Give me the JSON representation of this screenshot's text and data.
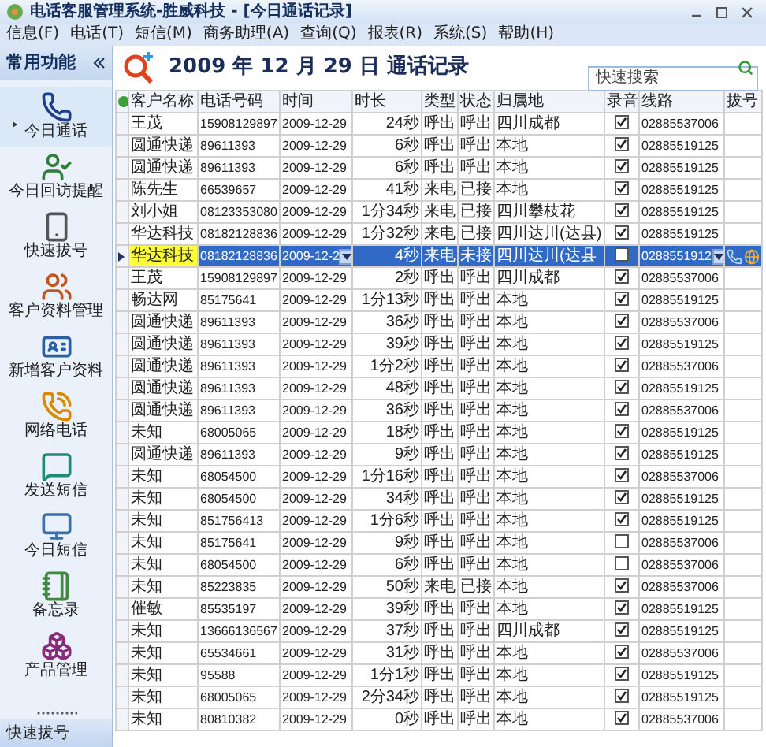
{
  "window": {
    "title": "电话客服管理系统-胜威科技 - [今日通话记录]"
  },
  "menu": [
    "信息(F)",
    "电话(T)",
    "短信(M)",
    "商务助理(A)",
    "查询(Q)",
    "报表(R)",
    "系统(S)",
    "帮助(H)"
  ],
  "sidebar": {
    "title": "常用功能",
    "items": [
      {
        "label": "今日通话",
        "selected": true
      },
      {
        "label": "今日回访提醒",
        "selected": false
      },
      {
        "label": "快速拔号",
        "selected": false
      },
      {
        "label": "客户资料管理",
        "selected": false
      },
      {
        "label": "新增客户资料",
        "selected": false
      },
      {
        "label": "网络电话",
        "selected": false
      },
      {
        "label": "发送短信",
        "selected": false
      },
      {
        "label": "今日短信",
        "selected": false
      },
      {
        "label": "备忘录",
        "selected": false
      },
      {
        "label": "产品管理",
        "selected": false
      }
    ],
    "footer": "快速拔号"
  },
  "header": {
    "title": "2009 年 12 月 29 日 通话记录",
    "search": {
      "placeholder": "快速搜索"
    }
  },
  "table": {
    "columns": [
      "客户名称",
      "电话号码",
      "时间",
      "时长",
      "类型",
      "状态",
      "归属地",
      "录音",
      "线路",
      "拔号"
    ],
    "rows": [
      {
        "name": "王茂",
        "phone": "15908129897",
        "time": "2009-12-29",
        "duration": "24秒",
        "type": "呼出",
        "status": "呼出",
        "location": "四川成都",
        "recorded": true,
        "line": "02885537006",
        "selected": false
      },
      {
        "name": "圆通快递",
        "phone": "89611393",
        "time": "2009-12-29",
        "duration": "6秒",
        "type": "呼出",
        "status": "呼出",
        "location": "本地",
        "recorded": true,
        "line": "02885519125",
        "selected": false
      },
      {
        "name": "圆通快递",
        "phone": "89611393",
        "time": "2009-12-29",
        "duration": "6秒",
        "type": "呼出",
        "status": "呼出",
        "location": "本地",
        "recorded": true,
        "line": "02885519125",
        "selected": false
      },
      {
        "name": "陈先生",
        "phone": "66539657",
        "time": "2009-12-29",
        "duration": "41秒",
        "type": "来电",
        "status": "已接",
        "location": "本地",
        "recorded": true,
        "line": "02885519125",
        "selected": false
      },
      {
        "name": "刘小姐",
        "phone": "08123353080",
        "time": "2009-12-29",
        "duration": "1分34秒",
        "type": "来电",
        "status": "已接",
        "location": "四川攀枝花",
        "recorded": true,
        "line": "02885519125",
        "selected": false
      },
      {
        "name": "华达科技",
        "phone": "08182128836",
        "time": "2009-12-29",
        "duration": "1分32秒",
        "type": "来电",
        "status": "已接",
        "location": "四川达川(达县)",
        "recorded": true,
        "line": "02885519125",
        "selected": false
      },
      {
        "name": "华达科技",
        "phone": "08182128836",
        "time": "2009-12-2",
        "duration": "4秒",
        "type": "来电",
        "status": "未接",
        "location": "四川达川(达县",
        "recorded": false,
        "line": "0288551912",
        "selected": true
      },
      {
        "name": "王茂",
        "phone": "15908129897",
        "time": "2009-12-29",
        "duration": "2秒",
        "type": "呼出",
        "status": "呼出",
        "location": "四川成都",
        "recorded": true,
        "line": "02885537006",
        "selected": false
      },
      {
        "name": "畅达网",
        "phone": "85175641",
        "time": "2009-12-29",
        "duration": "1分13秒",
        "type": "呼出",
        "status": "呼出",
        "location": "本地",
        "recorded": true,
        "line": "02885519125",
        "selected": false
      },
      {
        "name": "圆通快递",
        "phone": "89611393",
        "time": "2009-12-29",
        "duration": "36秒",
        "type": "呼出",
        "status": "呼出",
        "location": "本地",
        "recorded": true,
        "line": "02885537006",
        "selected": false
      },
      {
        "name": "圆通快递",
        "phone": "89611393",
        "time": "2009-12-29",
        "duration": "39秒",
        "type": "呼出",
        "status": "呼出",
        "location": "本地",
        "recorded": true,
        "line": "02885519125",
        "selected": false
      },
      {
        "name": "圆通快递",
        "phone": "89611393",
        "time": "2009-12-29",
        "duration": "1分2秒",
        "type": "呼出",
        "status": "呼出",
        "location": "本地",
        "recorded": true,
        "line": "02885537006",
        "selected": false
      },
      {
        "name": "圆通快递",
        "phone": "89611393",
        "time": "2009-12-29",
        "duration": "48秒",
        "type": "呼出",
        "status": "呼出",
        "location": "本地",
        "recorded": true,
        "line": "02885519125",
        "selected": false
      },
      {
        "name": "圆通快递",
        "phone": "89611393",
        "time": "2009-12-29",
        "duration": "36秒",
        "type": "呼出",
        "status": "呼出",
        "location": "本地",
        "recorded": true,
        "line": "02885537006",
        "selected": false
      },
      {
        "name": "未知",
        "phone": "68005065",
        "time": "2009-12-29",
        "duration": "18秒",
        "type": "呼出",
        "status": "呼出",
        "location": "本地",
        "recorded": true,
        "line": "02885519125",
        "selected": false
      },
      {
        "name": "圆通快递",
        "phone": "89611393",
        "time": "2009-12-29",
        "duration": "9秒",
        "type": "呼出",
        "status": "呼出",
        "location": "本地",
        "recorded": true,
        "line": "02885519125",
        "selected": false
      },
      {
        "name": "未知",
        "phone": "68054500",
        "time": "2009-12-29",
        "duration": "1分16秒",
        "type": "呼出",
        "status": "呼出",
        "location": "本地",
        "recorded": true,
        "line": "02885537006",
        "selected": false
      },
      {
        "name": "未知",
        "phone": "68054500",
        "time": "2009-12-29",
        "duration": "34秒",
        "type": "呼出",
        "status": "呼出",
        "location": "本地",
        "recorded": true,
        "line": "02885519125",
        "selected": false
      },
      {
        "name": "未知",
        "phone": "851756413",
        "time": "2009-12-29",
        "duration": "1分6秒",
        "type": "呼出",
        "status": "呼出",
        "location": "本地",
        "recorded": true,
        "line": "02885519125",
        "selected": false
      },
      {
        "name": "未知",
        "phone": "85175641",
        "time": "2009-12-29",
        "duration": "9秒",
        "type": "呼出",
        "status": "呼出",
        "location": "本地",
        "recorded": false,
        "line": "02885537006",
        "selected": false
      },
      {
        "name": "未知",
        "phone": "68054500",
        "time": "2009-12-29",
        "duration": "6秒",
        "type": "呼出",
        "status": "呼出",
        "location": "本地",
        "recorded": false,
        "line": "02885537006",
        "selected": false
      },
      {
        "name": "未知",
        "phone": "85223835",
        "time": "2009-12-29",
        "duration": "50秒",
        "type": "来电",
        "status": "已接",
        "location": "本地",
        "recorded": true,
        "line": "02885537006",
        "selected": false
      },
      {
        "name": "催敏",
        "phone": "85535197",
        "time": "2009-12-29",
        "duration": "39秒",
        "type": "呼出",
        "status": "呼出",
        "location": "本地",
        "recorded": true,
        "line": "02885519125",
        "selected": false
      },
      {
        "name": "未知",
        "phone": "13666136567",
        "time": "2009-12-29",
        "duration": "37秒",
        "type": "呼出",
        "status": "呼出",
        "location": "四川成都",
        "recorded": true,
        "line": "02885519125",
        "selected": false
      },
      {
        "name": "未知",
        "phone": "65534661",
        "time": "2009-12-29",
        "duration": "31秒",
        "type": "呼出",
        "status": "呼出",
        "location": "本地",
        "recorded": true,
        "line": "02885537006",
        "selected": false
      },
      {
        "name": "未知",
        "phone": "95588",
        "time": "2009-12-29",
        "duration": "1分1秒",
        "type": "呼出",
        "status": "呼出",
        "location": "本地",
        "recorded": true,
        "line": "02885519125",
        "selected": false
      },
      {
        "name": "未知",
        "phone": "68005065",
        "time": "2009-12-29",
        "duration": "2分34秒",
        "type": "呼出",
        "status": "呼出",
        "location": "本地",
        "recorded": true,
        "line": "02885519125",
        "selected": false
      },
      {
        "name": "未知",
        "phone": "80810382",
        "time": "2009-12-29",
        "duration": "0秒",
        "type": "呼出",
        "status": "呼出",
        "location": "本地",
        "recorded": true,
        "line": "02885537006",
        "selected": false
      }
    ]
  }
}
